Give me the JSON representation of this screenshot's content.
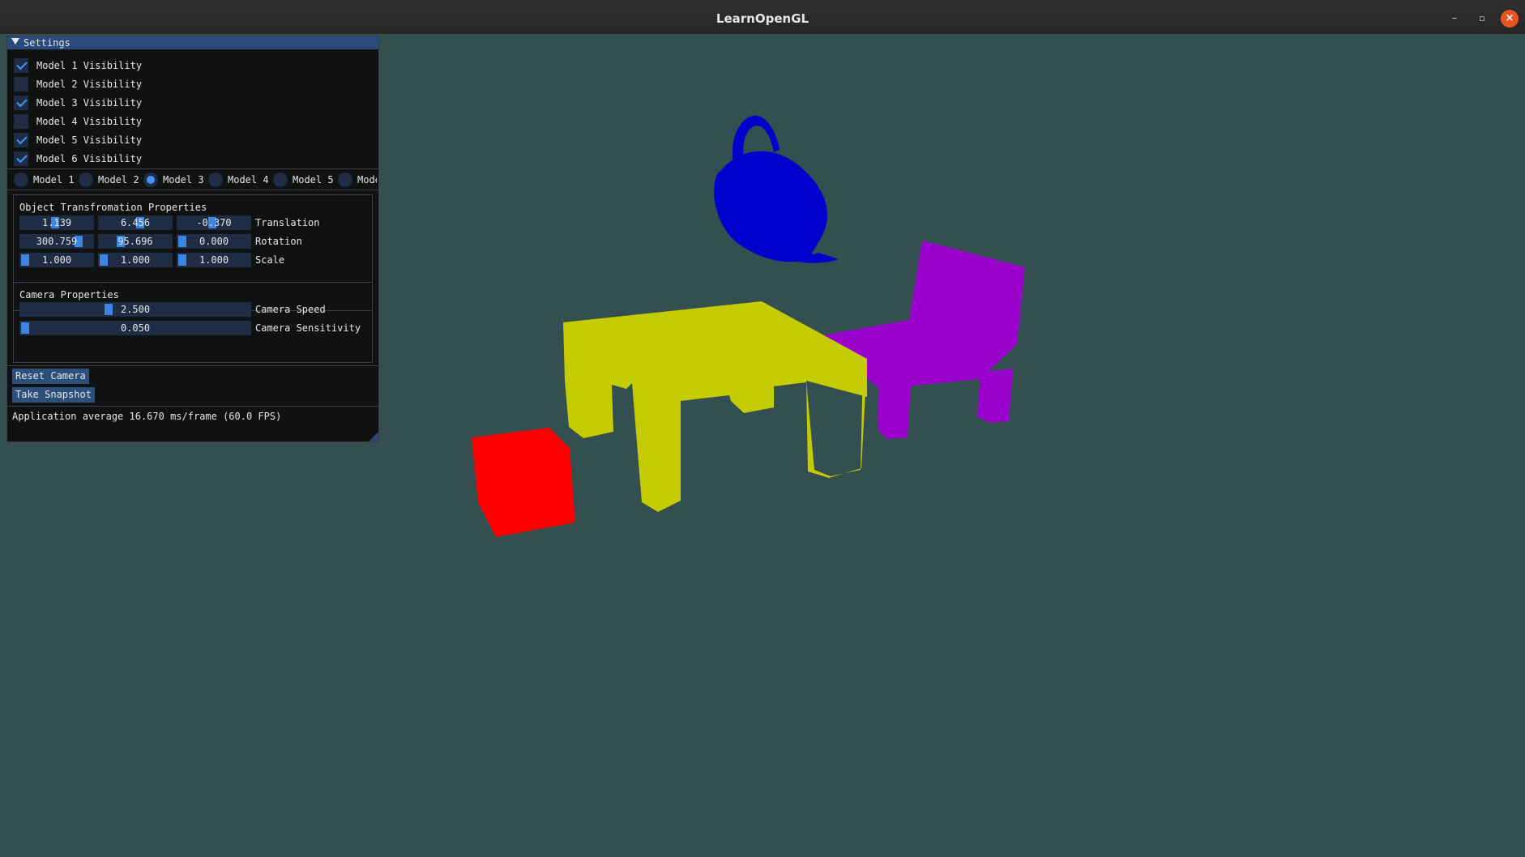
{
  "window": {
    "title": "LearnOpenGL",
    "minimize": "–",
    "maximize": "▫",
    "close": "×"
  },
  "scene": {
    "background": "#334f4f",
    "objects": [
      {
        "name": "teapot",
        "color": "#0000cc"
      },
      {
        "name": "table",
        "color": "#c4cc00"
      },
      {
        "name": "chair",
        "color": "#9900cc"
      },
      {
        "name": "cube",
        "color": "#ff0000"
      }
    ]
  },
  "settings": {
    "title": "Settings",
    "visibility": [
      {
        "label": "Model 1 Visibility",
        "checked": true
      },
      {
        "label": "Model 2 Visibility",
        "checked": false
      },
      {
        "label": "Model 3 Visibility",
        "checked": true
      },
      {
        "label": "Model 4 Visibility",
        "checked": false
      },
      {
        "label": "Model 5 Visibility",
        "checked": true
      },
      {
        "label": "Model 6 Visibility",
        "checked": true
      }
    ],
    "models": [
      {
        "label": "Model 1",
        "selected": false
      },
      {
        "label": "Model 2",
        "selected": false
      },
      {
        "label": "Model 3",
        "selected": true
      },
      {
        "label": "Model 4",
        "selected": false
      },
      {
        "label": "Model 5",
        "selected": false
      },
      {
        "label": "Mode",
        "selected": false
      }
    ],
    "transform": {
      "title": "Object Transfromation Properties",
      "rows": [
        {
          "label": "Translation",
          "values": [
            "1.139",
            "6.456",
            "-0.370"
          ],
          "fill": [
            0.48,
            0.58,
            0.48
          ]
        },
        {
          "label": "Rotation",
          "values": [
            "300.759",
            "95.696",
            "0.000"
          ],
          "fill": [
            0.84,
            0.27,
            0.0
          ]
        },
        {
          "label": "Scale",
          "values": [
            "1.000",
            "1.000",
            "1.000"
          ],
          "fill": [
            0.0,
            0.0,
            0.0
          ]
        }
      ]
    },
    "camera": {
      "title": "Camera Properties",
      "speed": {
        "label": "Camera Speed",
        "value": "2.500",
        "fill": 0.38
      },
      "sensitivity": {
        "label": "Camera Sensitivity",
        "value": "0.050",
        "fill": 0.0
      }
    },
    "buttons": {
      "reset": "Reset Camera",
      "snapshot": "Take Snapshot"
    },
    "fps": "Application average 16.670 ms/frame (60.0 FPS)"
  }
}
